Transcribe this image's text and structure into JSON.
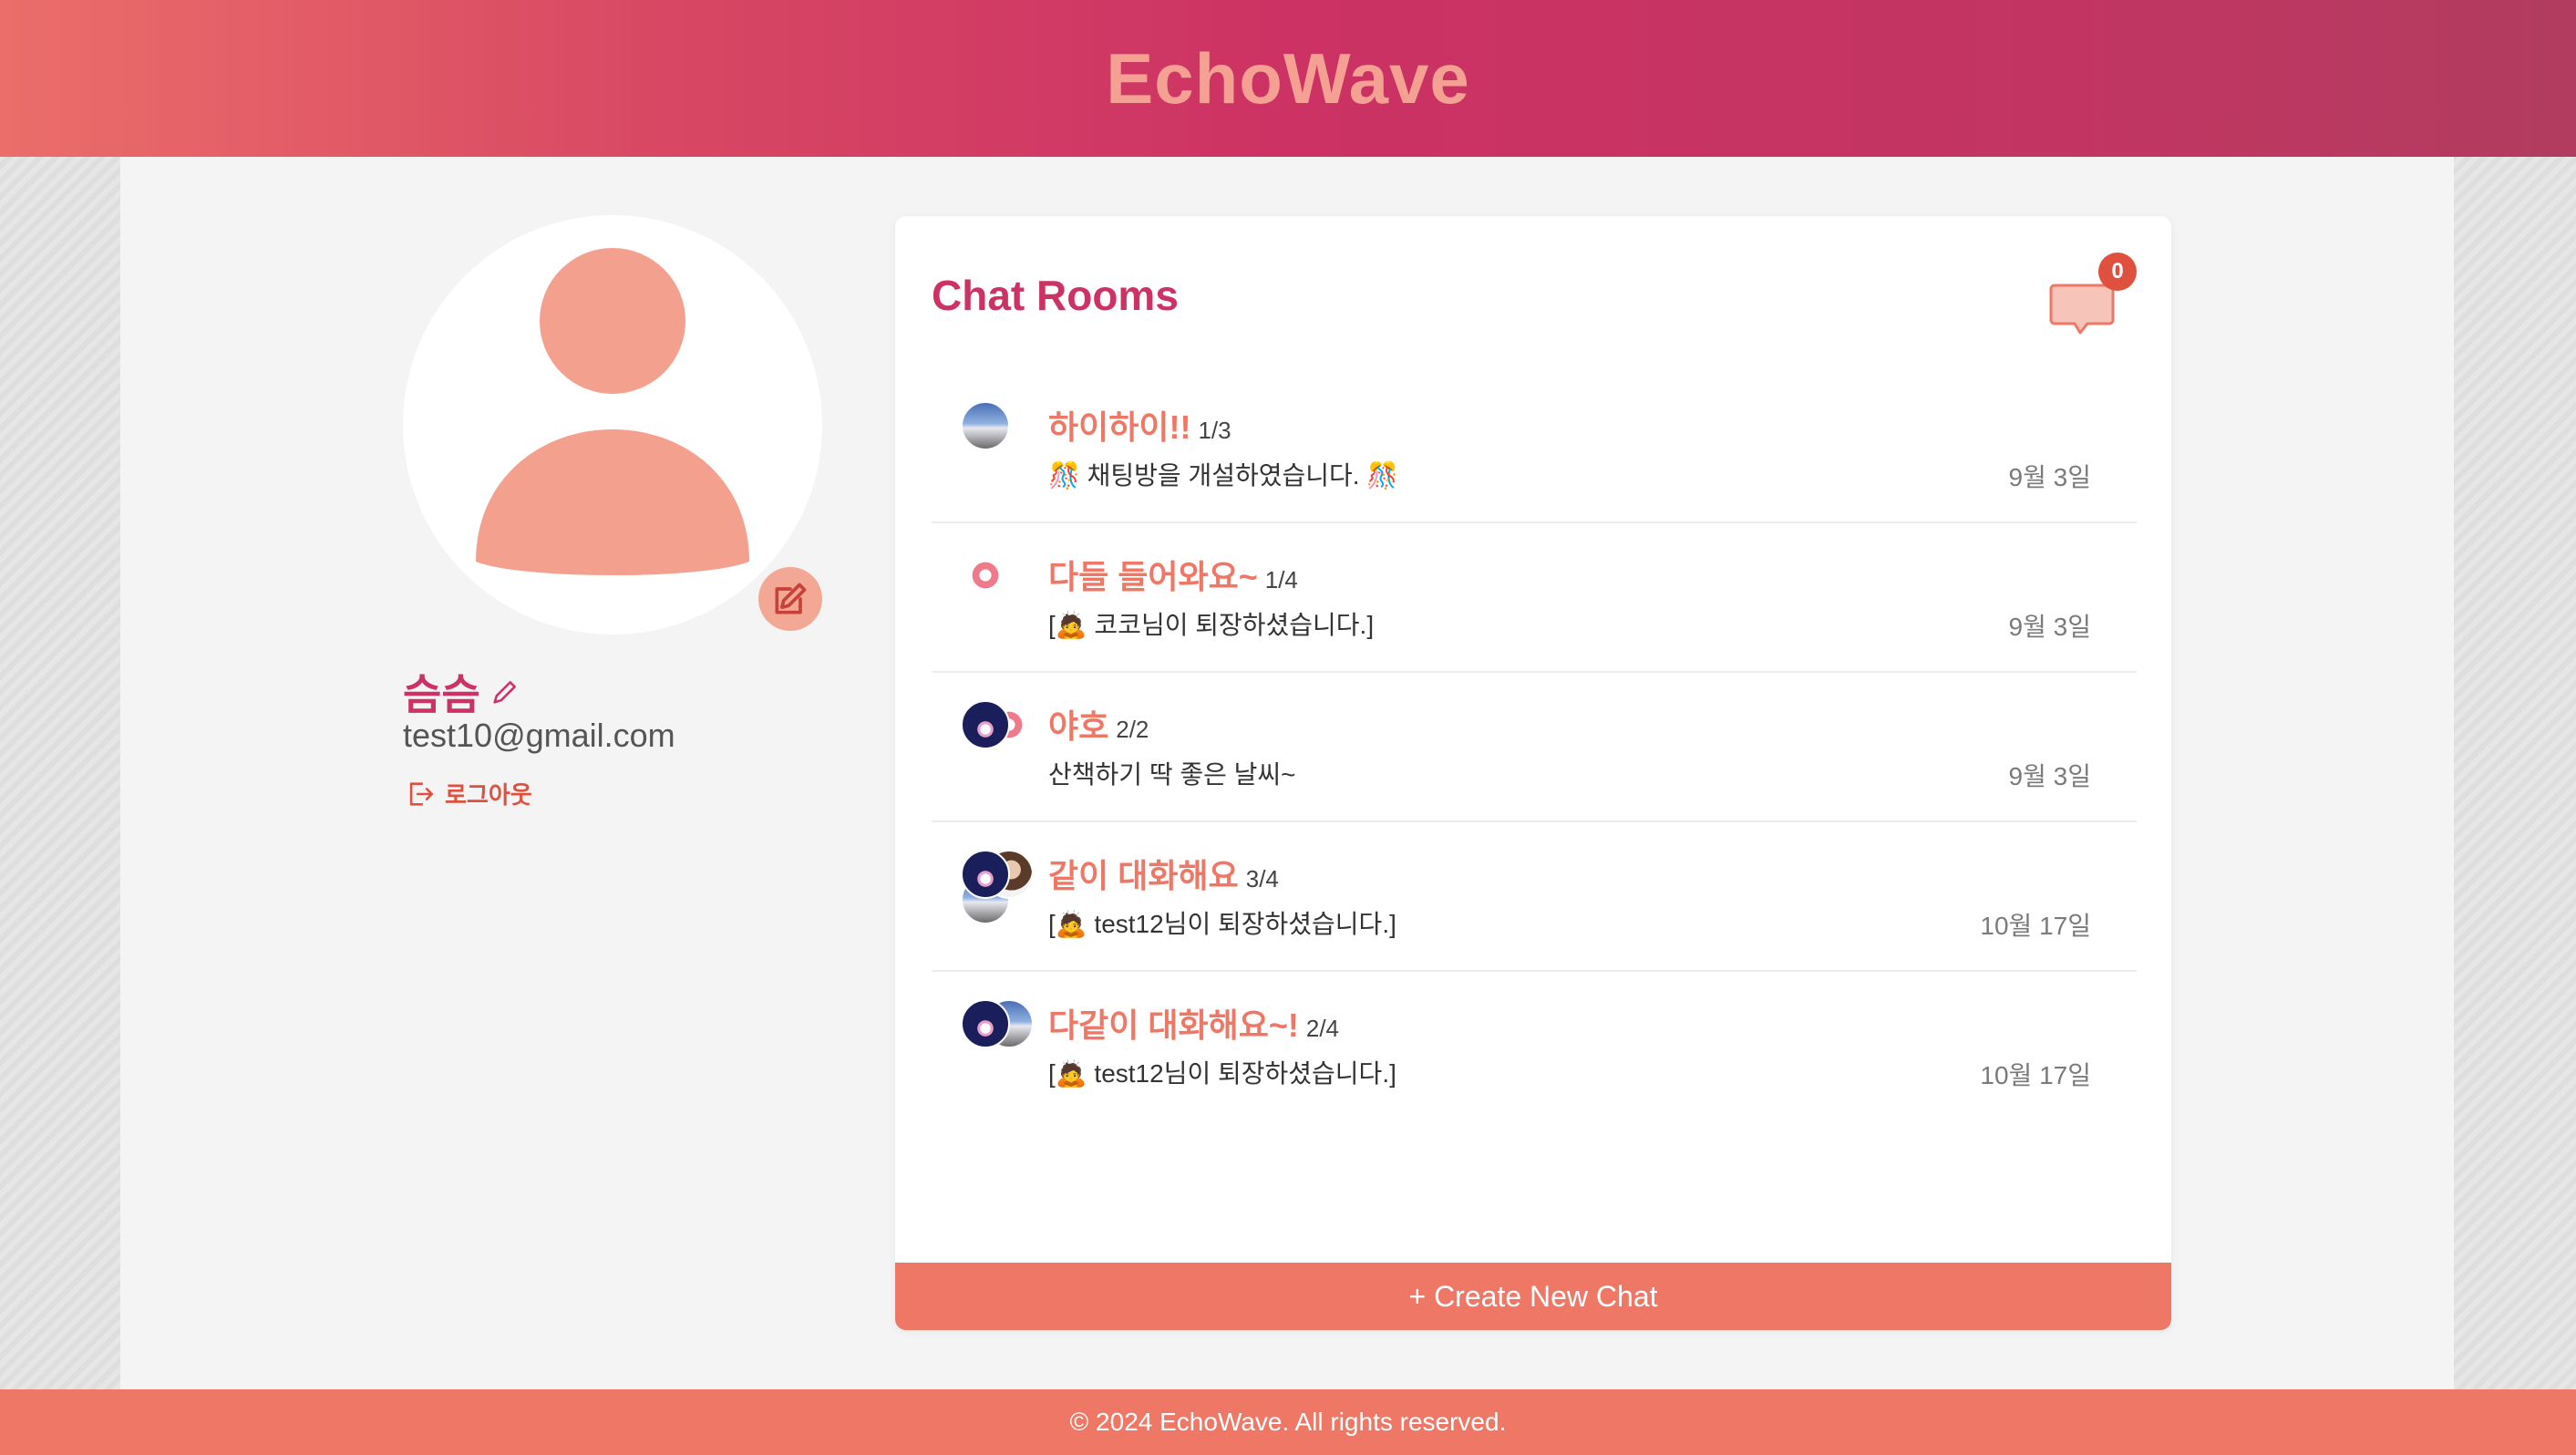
{
  "app": {
    "title": "EchoWave"
  },
  "profile": {
    "username": "슴슴",
    "email": "test10@gmail.com",
    "logout_label": "로그아웃"
  },
  "chat_panel": {
    "title": "Chat Rooms",
    "unread_count": "0",
    "create_button_label": "+ Create New Chat",
    "rooms": [
      {
        "name": "하이하이!!",
        "count": "1/3",
        "last_message": "🎊 채팅방을 개설하였습니다. 🎊",
        "date": "9월 3일",
        "avatars": [
          "day"
        ]
      },
      {
        "name": "다들 들어와요~",
        "count": "1/4",
        "last_message": "[🙇 코코님이 퇴장하셨습니다.]",
        "date": "9월 3일",
        "avatars": [
          "pink"
        ]
      },
      {
        "name": "야호",
        "count": "2/2",
        "last_message": "산책하기 딱 좋은 날씨~",
        "date": "9월 3일",
        "avatars": [
          "night",
          "pink"
        ]
      },
      {
        "name": "같이 대화해요",
        "count": "3/4",
        "last_message": "[🙇 test12님이 퇴장하셨습니다.]",
        "date": "10월 17일",
        "avatars": [
          "night",
          "person",
          "day"
        ]
      },
      {
        "name": "다같이 대화해요~!",
        "count": "2/4",
        "last_message": "[🙇 test12님이 퇴장하셨습니다.]",
        "date": "10월 17일",
        "avatars": [
          "night",
          "day"
        ]
      }
    ]
  },
  "footer": {
    "text": "© 2024 EchoWave. All rights reserved."
  },
  "colors": {
    "accent": "#ef7766",
    "brand": "#cc3264",
    "header_title": "#f4a194",
    "avatar_fill": "#f3a08e",
    "badge": "#e0503e"
  },
  "icons": {
    "avatar_placeholder": "person-silhouette-icon",
    "edit_avatar": "pencil-square-icon",
    "edit_name": "pencil-icon",
    "logout": "logout-icon",
    "messages": "chat-bubble-icon"
  }
}
